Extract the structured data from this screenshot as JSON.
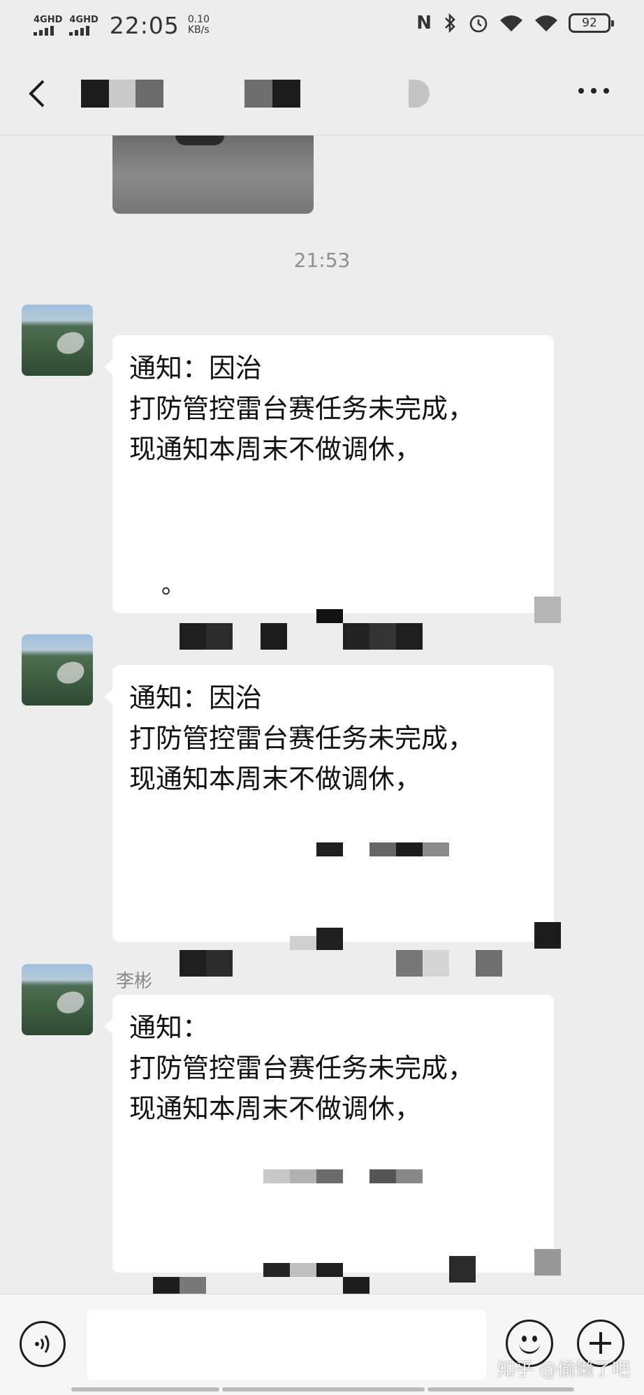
{
  "status_bar": {
    "signal1_label": "4GHD",
    "signal2_label": "4GHD",
    "time": "22:05",
    "speed_value": "0.10",
    "speed_unit": "KB/s",
    "nfc": "N",
    "battery": "92"
  },
  "chat": {
    "timestamp": "21:53",
    "messages": [
      {
        "sender": "",
        "lines": [
          "通知：因治",
          "打防管控雷台赛任务未完成，",
          "现通知本周末不做调休，"
        ],
        "trailing": "。"
      },
      {
        "sender": "",
        "lines": [
          "通知：因治",
          "打防管控雷台赛任务未完成，",
          "现通知本周末不做调休，"
        ],
        "trailing": ""
      },
      {
        "sender": "李彬",
        "lines": [
          "通知：",
          "打防管控雷台赛任务未完成，",
          "现通知本周末不做调休，"
        ],
        "trailing": ""
      }
    ]
  },
  "watermark": "知乎 @偷懒了吧",
  "colors": {
    "background": "#ededed",
    "bubble": "#ffffff",
    "accent": "#1d1d1d"
  },
  "icons": [
    "back-icon",
    "more-icon",
    "voice-icon",
    "emoji-icon",
    "add-icon"
  ]
}
